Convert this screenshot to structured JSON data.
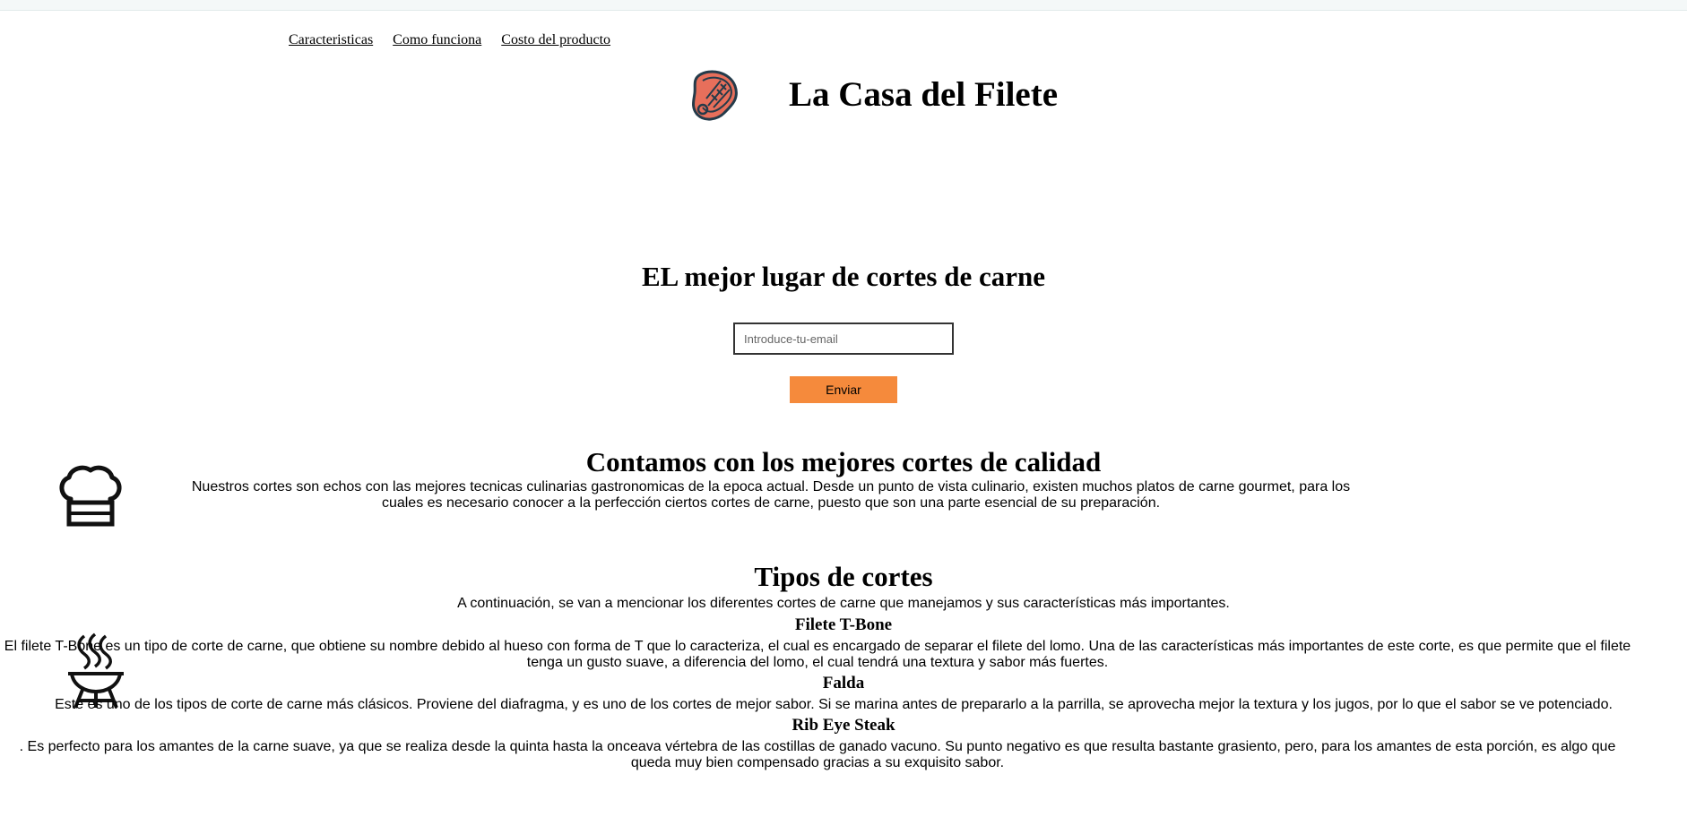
{
  "nav": {
    "items": [
      {
        "label": "Caracteristicas"
      },
      {
        "label": "Como funciona"
      },
      {
        "label": "Costo del producto"
      }
    ]
  },
  "header": {
    "title": "La Casa del Filete",
    "logo_icon": "steak-icon",
    "logo_color": "#e76f5b"
  },
  "hero": {
    "title": "EL mejor lugar de cortes de carne",
    "email_placeholder": "Introduce-tu-email",
    "email_value": "",
    "submit_label": "Enviar",
    "submit_color": "#f58a3c"
  },
  "quality": {
    "icon": "chef-hat-icon",
    "title": "Contamos con los mejores cortes de calidad",
    "text": "Nuestros cortes son echos con las mejores tecnicas culinarias gastronomicas de la epoca actual. Desde un punto de vista culinario, existen muchos platos de carne gourmet, para los cuales es necesario conocer a la perfección ciertos cortes de carne, puesto que son una parte esencial de su preparación."
  },
  "cuts": {
    "icon": "grill-icon",
    "title": "Tipos de cortes",
    "intro": "A continuación, se van a mencionar los diferentes cortes de carne que manejamos y sus características más importantes.",
    "items": [
      {
        "name": "Filete T-Bone",
        "text": "El filete T-Bone es un tipo de corte de carne, que obtiene su nombre debido al hueso con forma de T que lo caracteriza, el cual es encargado de separar el filete del lomo. Una de las características más importantes de este corte, es que permite que el filete tenga un gusto suave, a diferencia del lomo, el cual tendrá una textura y sabor más fuertes."
      },
      {
        "name": "Falda",
        "text": "Este es uno de los tipos de corte de carne más clásicos. Proviene del diafragma, y es uno de los cortes de mejor sabor. Si se marina antes de prepararlo a la parrilla, se aprovecha mejor la textura y los jugos, por lo que el sabor se ve potenciado."
      },
      {
        "name": "Rib Eye Steak",
        "text": ". Es perfecto para los amantes de la carne suave, ya que se realiza desde la quinta hasta la onceava vértebra de las costillas de ganado vacuno. Su punto negativo es que resulta bastante grasiento, pero, para los amantes de esta porción, es algo que queda muy bien compensado gracias a su exquisito sabor."
      }
    ]
  }
}
